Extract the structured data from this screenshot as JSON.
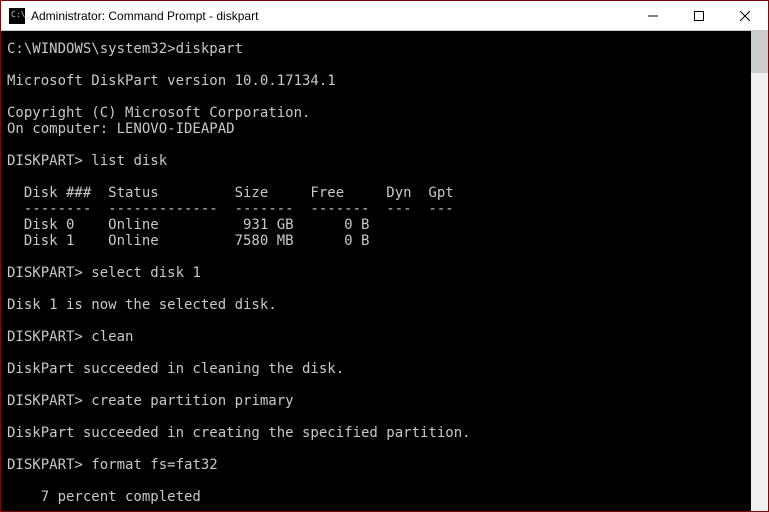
{
  "titlebar": {
    "title": "Administrator: Command Prompt - diskpart"
  },
  "prompts": {
    "initial": "C:\\WINDOWS\\system32>",
    "diskpart": "DISKPART>"
  },
  "commands": {
    "launch": "diskpart",
    "list": "list disk",
    "select": "select disk 1",
    "clean": "clean",
    "create": "create partition primary",
    "format": "format fs=fat32"
  },
  "output": {
    "version_line": "Microsoft DiskPart version 10.0.17134.1",
    "copyright": "Copyright (C) Microsoft Corporation.",
    "computer": "On computer: LENOVO-IDEAPAD",
    "table_header": "  Disk ###  Status         Size     Free     Dyn  Gpt",
    "table_rule": "  --------  -------------  -------  -------  ---  ---",
    "table_row0": "  Disk 0    Online          931 GB      0 B",
    "table_row1": "  Disk 1    Online         7580 MB      0 B",
    "selected": "Disk 1 is now the selected disk.",
    "clean_ok": "DiskPart succeeded in cleaning the disk.",
    "create_ok": "DiskPart succeeded in creating the specified partition.",
    "progress": "    7 percent completed"
  }
}
